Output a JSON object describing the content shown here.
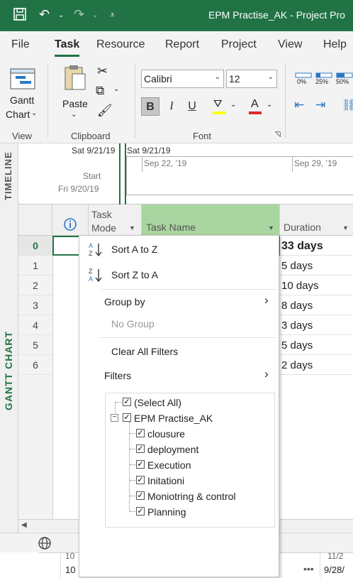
{
  "window": {
    "title": "EPM Practise_AK  -  Project Pro"
  },
  "tabs": [
    "File",
    "Task",
    "Resource",
    "Report",
    "Project",
    "View",
    "Help"
  ],
  "ribbon": {
    "view_group": {
      "label": "View",
      "gantt_label": "Gantt",
      "chart_label": "Chart"
    },
    "clipboard_group": {
      "label": "Clipboard",
      "paste_label": "Paste"
    },
    "font_group": {
      "label": "Font",
      "font_name": "Calibri",
      "font_size": "12",
      "bold": "B",
      "italic": "I",
      "underline": "U",
      "font_color_letter": "A"
    },
    "schedule_group": {
      "pct": [
        "0%",
        "25%",
        "50%"
      ]
    }
  },
  "timeline": {
    "side_label": "TIMELINE",
    "date_top1": "Sat 9/21/19",
    "date_top2": "Sat 9/21/19",
    "tick1": "Sep 22, '19",
    "tick2": "Sep 29, '19",
    "start_label": "Start",
    "start_date": "Fri 9/20/19"
  },
  "gantt": {
    "side_label": "GANTT CHART",
    "headers": {
      "task_mode_1": "Task",
      "task_mode_2": "Mode",
      "task_name": "Task Name",
      "duration": "Duration"
    },
    "rows": [
      {
        "num": "0",
        "duration": "33 days"
      },
      {
        "num": "1",
        "duration": "5 days"
      },
      {
        "num": "2",
        "duration": "10 days"
      },
      {
        "num": "3",
        "duration": "8 days"
      },
      {
        "num": "4",
        "duration": "3 days"
      },
      {
        "num": "5",
        "duration": "5 days"
      },
      {
        "num": "6",
        "duration": "2 days"
      }
    ]
  },
  "menu": {
    "sort_az": "Sort A to Z",
    "sort_za": "Sort Z to A",
    "group_by": "Group by",
    "no_group": "No Group",
    "clear_filters": "Clear All Filters",
    "filters": "Filters",
    "tree": {
      "select_all": "(Select All)",
      "project": "EPM Practise_AK",
      "items": [
        "clousure",
        "deployment",
        "Execution",
        "Initationi",
        "Moniotring & control",
        "Planning"
      ]
    }
  },
  "bottom": {
    "frag1": "10",
    "frag2": "9/28/",
    "frag3": "11/2"
  },
  "colors": {
    "accent": "#217346",
    "header_green": "#a9d5a0",
    "menu_border": "#c6c6c6"
  }
}
